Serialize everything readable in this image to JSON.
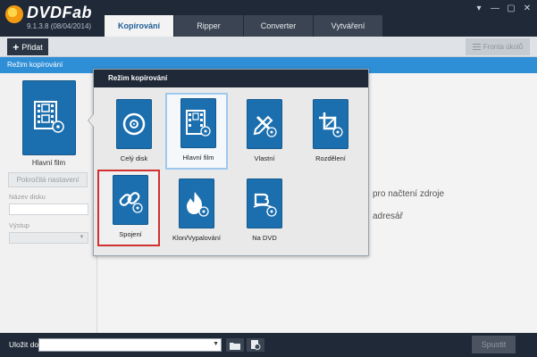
{
  "app": {
    "name": "DVDFab",
    "version": "9.1.3.8 (08/04/2014)"
  },
  "tabs": [
    "Kopírování",
    "Ripper",
    "Converter",
    "Vytváření"
  ],
  "window_controls": [
    "▾",
    "—",
    "▢",
    "✕"
  ],
  "toolbar": {
    "add_label": "Přidat",
    "queue_label": "Fronta úkolů"
  },
  "mode_header": "Režim kopírování",
  "left_panel": {
    "current_mode_label": "Hlavní film",
    "advanced_button": "Pokročilá nastavení",
    "disc_name_label": "Název disku",
    "disc_name_value": "",
    "output_label": "Výstup",
    "output_value": ""
  },
  "main_area": {
    "hint_source": "pro načtení zdroje",
    "hint_address": "adresář"
  },
  "popup": {
    "title": "Režim kopírování",
    "modes": [
      {
        "label": "Celý disk",
        "icon": "disc-icon"
      },
      {
        "label": "Hlavní film",
        "icon": "film-icon",
        "state": "selected"
      },
      {
        "label": "Vlastní",
        "icon": "pencil-ruler-icon"
      },
      {
        "label": "Rozdělení",
        "icon": "crop-icon"
      },
      {
        "label": "Spojení",
        "icon": "chain-link-icon",
        "state": "highlighted"
      },
      {
        "label": "Klon/Vypalování",
        "icon": "flame-icon"
      },
      {
        "label": "Na DVD",
        "icon": "bluray-to-dvd-icon"
      }
    ]
  },
  "bottom_bar": {
    "save_to_label": "Uložit do:",
    "save_to_value": "",
    "start_button": "Spustit"
  },
  "colors": {
    "titlebar": "#1f2937",
    "accent_blue": "#2f8fd6",
    "tile_blue": "#1c6fae",
    "highlight_red": "#d03030"
  }
}
